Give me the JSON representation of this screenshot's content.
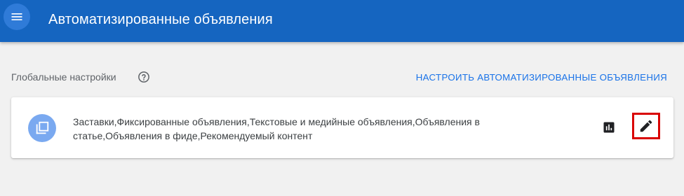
{
  "appbar": {
    "title": "Автоматизированные объявления",
    "menu_icon": "menu-icon",
    "background_color": "#1565c0"
  },
  "section": {
    "title": "Глобальные настройки",
    "help_icon": "help-icon",
    "configure_label": "НАСТРОИТЬ АВТОМАТИЗИРОВАННЫЕ ОБЪЯВЛЕНИЯ"
  },
  "card": {
    "avatar_icon": "library-icon",
    "description": "Заставки,Фиксированные объявления,Текстовые и медийные объявления,Объявления в статье,Объявления в фиде,Рекомендуемый контент",
    "stats_icon": "bar-chart-icon",
    "edit_icon": "pencil-icon",
    "highlight_color": "#d90000"
  }
}
